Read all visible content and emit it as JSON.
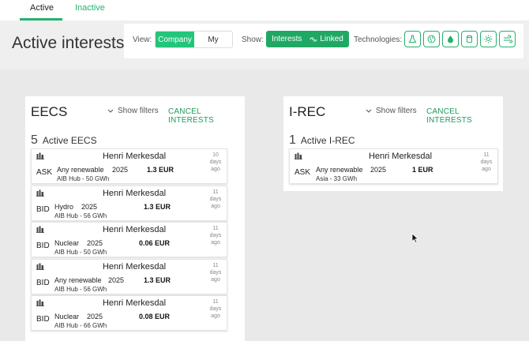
{
  "tabs": {
    "active": "Active",
    "inactive": "Inactive"
  },
  "header": {
    "title": "Active interests",
    "view_label": "View:",
    "view_options": [
      "Company",
      "My"
    ],
    "show_label": "Show:",
    "show_options": [
      "Interests",
      "Linked"
    ],
    "technologies_label": "Technologies:",
    "technology_icons": [
      "flask-icon",
      "globe-icon",
      "water-drop-icon",
      "cylinder-icon",
      "sun-icon",
      "wind-icon"
    ]
  },
  "colors": {
    "accent": "#23b26d",
    "accent_dark": "#1fa864"
  },
  "eecs": {
    "title": "EECS",
    "show_filters": "Show filters",
    "cancel": "CANCEL INTERESTS",
    "count": "5",
    "count_label": "Active EECS",
    "orders": [
      {
        "name": "Henri Merkesdal",
        "type": "ASK",
        "tech": "Any renewable",
        "year": "2025",
        "price": "1.3 EUR",
        "sub": "AIB Hub - 50 GWh",
        "age_num": "10",
        "age_unit": "days",
        "age_suffix": "ago"
      },
      {
        "name": "Henri Merkesdal",
        "type": "BID",
        "tech": "Hydro",
        "year": "2025",
        "price": "1.3 EUR",
        "sub": "AIB Hub - 56 GWh",
        "age_num": "11",
        "age_unit": "days",
        "age_suffix": "ago"
      },
      {
        "name": "Henri Merkesdal",
        "type": "BID",
        "tech": "Nuclear",
        "year": "2025",
        "price": "0.06 EUR",
        "sub": "AIB Hub - 50 GWh",
        "age_num": "11",
        "age_unit": "days",
        "age_suffix": "ago"
      },
      {
        "name": "Henri Merkesdal",
        "type": "BID",
        "tech": "Any renewable",
        "year": "2025",
        "price": "1.3 EUR",
        "sub": "AIB Hub - 56 GWh",
        "age_num": "11",
        "age_unit": "days",
        "age_suffix": "ago"
      },
      {
        "name": "Henri Merkesdal",
        "type": "BID",
        "tech": "Nuclear",
        "year": "2025",
        "price": "0.08 EUR",
        "sub": "AIB Hub - 66 GWh",
        "age_num": "11",
        "age_unit": "days",
        "age_suffix": "ago"
      }
    ]
  },
  "irec": {
    "title": "I-REC",
    "show_filters": "Show filters",
    "cancel": "CANCEL INTERESTS",
    "count": "1",
    "count_label": "Active I-REC",
    "orders": [
      {
        "name": "Henri Merkesdal",
        "type": "ASK",
        "tech": "Any renewable",
        "year": "2025",
        "price": "1 EUR",
        "sub": "Asia - 33 GWh",
        "age_num": "11",
        "age_unit": "days",
        "age_suffix": "ago"
      }
    ]
  }
}
